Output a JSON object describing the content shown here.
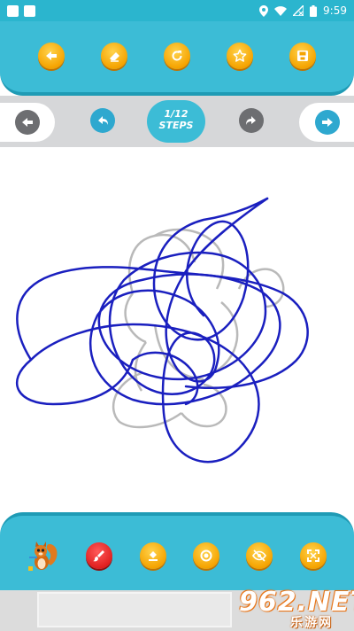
{
  "status_bar": {
    "time": "9:59"
  },
  "top_toolbar": {
    "buttons": [
      {
        "icon": "back-arrow-icon"
      },
      {
        "icon": "eraser-icon"
      },
      {
        "icon": "refresh-icon"
      },
      {
        "icon": "star-icon"
      },
      {
        "icon": "save-icon"
      }
    ]
  },
  "steps_bar": {
    "step_count": "1/12",
    "step_label": "STEPS",
    "left_nav_icon": "arrow-left-icon",
    "right_nav_icon": "arrow-right-icon",
    "undo_icon": "undo-icon",
    "redo_icon": "redo-icon"
  },
  "canvas": {
    "guide_color": "#b9b9b9",
    "stroke_color": "#1a1fbf"
  },
  "bottom_toolbar": {
    "buttons": [
      {
        "icon": "squirrel-mascot-icon"
      },
      {
        "icon": "brush-color-icon"
      },
      {
        "icon": "fill-bucket-icon"
      },
      {
        "icon": "brush-size-icon"
      },
      {
        "icon": "hide-guide-icon"
      },
      {
        "icon": "fullscreen-icon"
      }
    ]
  },
  "watermark": {
    "brand": "962.NET",
    "subtitle": "乐游网"
  },
  "colors": {
    "primary": "#3cbcd6",
    "accent_orange": "#f5a300",
    "accent_red": "#e02020",
    "nav_blue": "#2ea8cf",
    "nav_gray": "#6d6e71"
  }
}
